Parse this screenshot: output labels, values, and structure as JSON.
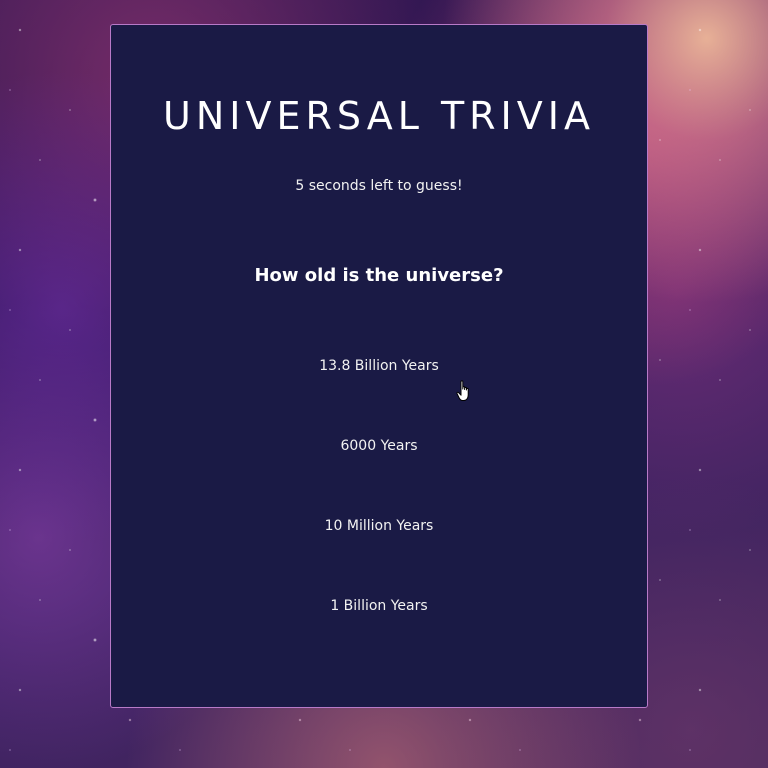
{
  "game": {
    "title": "UNIVERSAL TRIVIA",
    "timer_text": "5 seconds left to guess!",
    "question": "How old is the universe?",
    "answers": [
      "13.8 Billion Years",
      "6000 Years",
      "10 Million Years",
      "1 Billion Years"
    ]
  },
  "colors": {
    "card_background": "#1a1a45",
    "card_border": "#b87ac8",
    "text": "#ffffff"
  },
  "icons": {
    "pointer": "hand-pointer-icon"
  }
}
